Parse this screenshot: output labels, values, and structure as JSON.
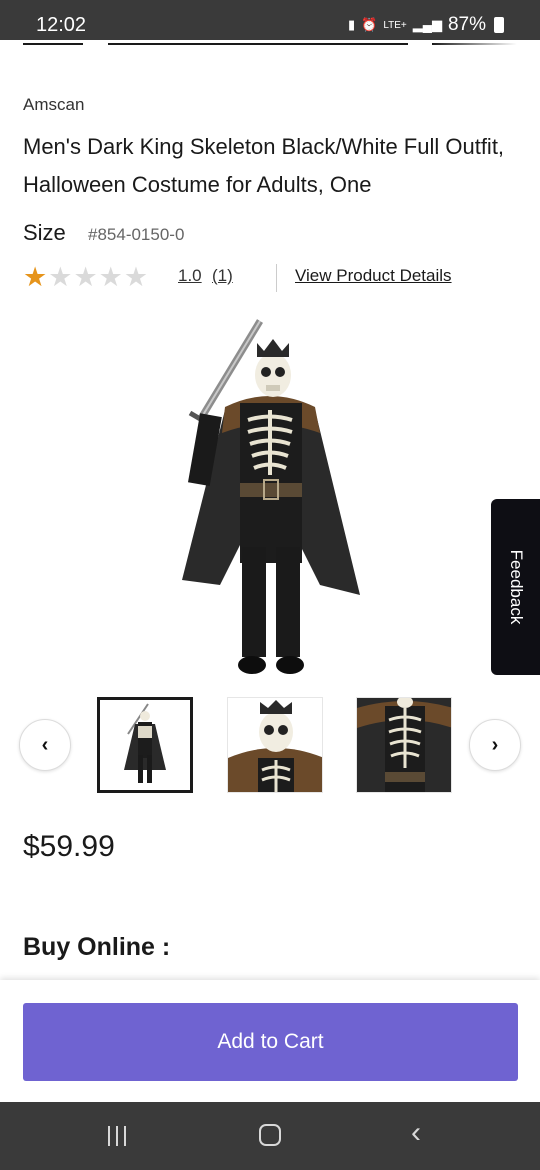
{
  "status_bar": {
    "time": "12:02",
    "network": "LTE+",
    "battery": "87%",
    "icons": [
      "lock-icon",
      "alarm-icon",
      "signal-icon",
      "battery-icon"
    ]
  },
  "product": {
    "brand": "Amscan",
    "title": "Men's Dark King Skeleton Black/White Full Outfit, Halloween Costume for Adults, One",
    "size_label": "Size",
    "sku": "#854-0150-0",
    "rating_value": "1.0",
    "rating_stars": 1,
    "rating_max": 5,
    "review_count": "(1)",
    "details_link": "View Product Details",
    "price": "$59.99"
  },
  "feedback_tab": {
    "label": "Feedback"
  },
  "carousel": {
    "prev_icon": "chevron-left-icon",
    "next_icon": "chevron-right-icon",
    "thumbnails": [
      "full-costume",
      "skull-crown-closeup",
      "torso-closeup"
    ],
    "selected_index": 0
  },
  "buy_online_heading": "Buy Online :",
  "cart": {
    "button_label": "Add to Cart"
  },
  "colors": {
    "accent": "#6f63d1",
    "star": "#e6941b",
    "feedback_bg": "#0e0e14",
    "status_bar_bg": "#3a3a3a"
  },
  "nav_bar": {
    "icons": [
      "recents-icon",
      "home-icon",
      "back-icon"
    ]
  }
}
